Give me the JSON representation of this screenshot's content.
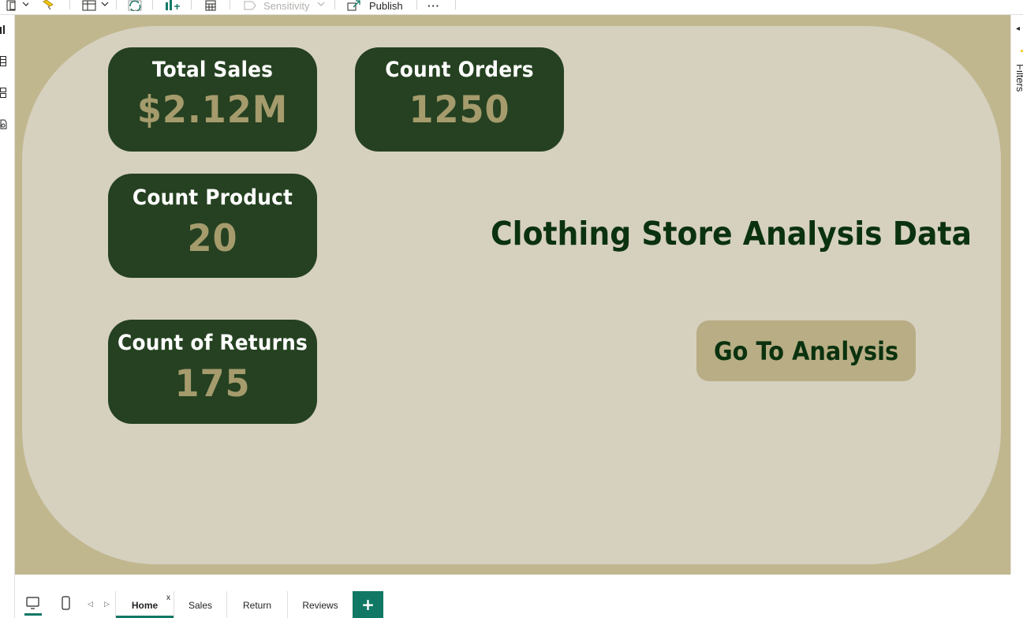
{
  "ribbon": {
    "sensitivity_label": "Sensitivity",
    "publish_label": "Publish",
    "more_label": "···"
  },
  "kpis": [
    {
      "title": "Total Sales",
      "value": "$2.12M"
    },
    {
      "title": "Count Orders",
      "value": "1250"
    },
    {
      "title": "Count Product",
      "value": "20"
    },
    {
      "title": "Count of Returns",
      "value": "175"
    }
  ],
  "report": {
    "title": "Clothing Store Analysis Data",
    "go_button_label": "Go To Analysis"
  },
  "filters_pane": {
    "label": "Filters"
  },
  "page_tabs": {
    "tabs": [
      {
        "label": "Home",
        "active": true
      },
      {
        "label": "Sales",
        "active": false
      },
      {
        "label": "Return",
        "active": false
      },
      {
        "label": "Reviews",
        "active": false
      }
    ],
    "close_label": "x",
    "add_label": "+"
  },
  "colors": {
    "canvas_outer": "#c1b78f",
    "panel": "#d6d0bf",
    "kpi_card": "#254121",
    "kpi_value": "#a59b6c",
    "title_text": "#0b320f",
    "button": "#b8ad84",
    "accent": "#117865"
  }
}
